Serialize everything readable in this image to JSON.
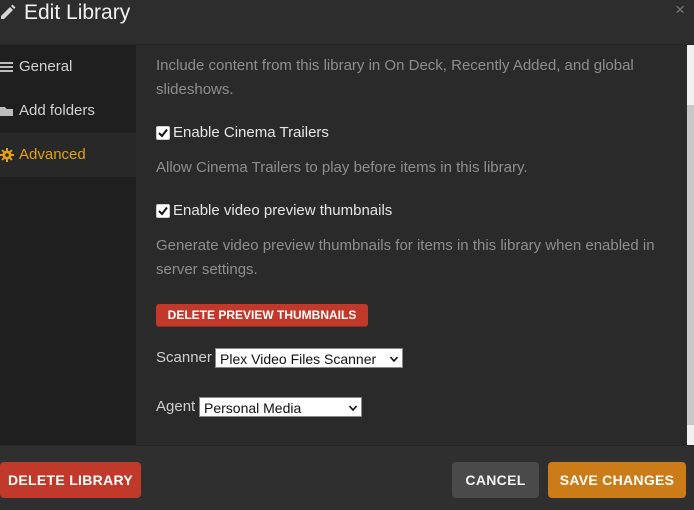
{
  "dialog": {
    "title": "Edit Library",
    "close_symbol": "×"
  },
  "sidebar": {
    "items": [
      {
        "label": "General",
        "icon": "list-icon"
      },
      {
        "label": "Add folders",
        "icon": "folder-icon"
      },
      {
        "label": "Advanced",
        "icon": "gear-icon",
        "active": true
      }
    ]
  },
  "content": {
    "intro_text": "Include content from this library in On Deck, Recently Added, and global slideshows.",
    "cinema_trailers": {
      "label": "Enable Cinema Trailers",
      "checked": true,
      "help": "Allow Cinema Trailers to play before items in this library."
    },
    "video_thumbnails": {
      "label": "Enable video preview thumbnails",
      "checked": true,
      "help": "Generate video preview thumbnails for items in this library when enabled in server settings."
    },
    "delete_thumbnails_label": "DELETE PREVIEW THUMBNAILS",
    "scanner": {
      "label": "Scanner",
      "value": "Plex Video Files Scanner"
    },
    "agent": {
      "label": "Agent",
      "value": "Personal Media"
    }
  },
  "footer": {
    "delete_library_label": "DELETE LIBRARY",
    "cancel_label": "CANCEL",
    "save_label": "SAVE CHANGES"
  },
  "colors": {
    "accent": "#e5a00d",
    "danger": "#c0392b",
    "save": "#cc7b19"
  }
}
